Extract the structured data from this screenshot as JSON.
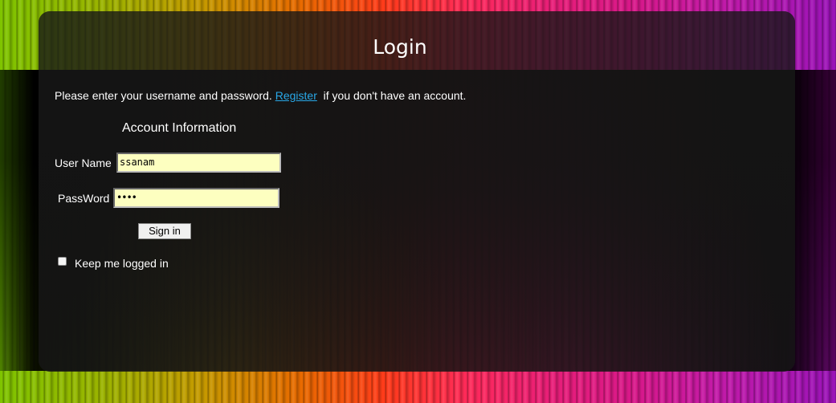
{
  "header": {
    "title": "Login"
  },
  "intro": {
    "text_before": "Please enter your username and password. ",
    "register_link": "Register",
    "text_after": "  if you don't have an account."
  },
  "form": {
    "section_title": "Account Information",
    "username_label": "User Name",
    "username_value": "ssanam",
    "password_label": "PassWord",
    "password_value": "••••",
    "signin_label": "Sign in",
    "remember_label": "Keep me logged in",
    "remember_checked": false
  },
  "colors": {
    "link": "#29a8e8",
    "input_bg": "#fdffc0",
    "text": "#ffffff"
  }
}
